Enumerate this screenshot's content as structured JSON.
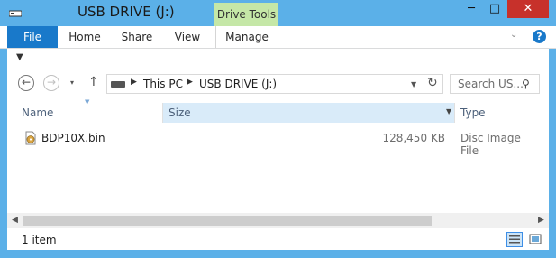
{
  "window": {
    "title": "USB DRIVE (J:)",
    "context_group": "Drive Tools",
    "controls": {
      "minimize": "─",
      "maximize": "□",
      "close": "✕"
    }
  },
  "ribbon": {
    "tabs": [
      {
        "label": "File"
      },
      {
        "label": "Home"
      },
      {
        "label": "Share"
      },
      {
        "label": "View"
      },
      {
        "label": "Manage"
      }
    ],
    "expand_icon": "chevron-down-icon",
    "help_label": "?"
  },
  "quick_access": {
    "customize_icon": "customize-toolbar-icon"
  },
  "navigation": {
    "back_icon": "←",
    "forward_icon": "→",
    "recent_icon": "▾",
    "up_icon": "↑"
  },
  "address": {
    "segments": [
      "This PC",
      "USB DRIVE (J:)"
    ],
    "separator": "▶"
  },
  "search": {
    "placeholder": "Search US..."
  },
  "columns": {
    "name": "Name",
    "size": "Size",
    "type": "Type"
  },
  "files": [
    {
      "name": "BDP10X.bin",
      "size": "128,450 KB",
      "type": "Disc Image File"
    }
  ],
  "status": {
    "item_count": "1 item"
  },
  "colors": {
    "title_bar": "#5bb0e8",
    "file_tab": "#1979ca",
    "context_tab": "#c5e7a7",
    "close_button": "#c7312b",
    "selected_column": "#d9ebf9"
  }
}
